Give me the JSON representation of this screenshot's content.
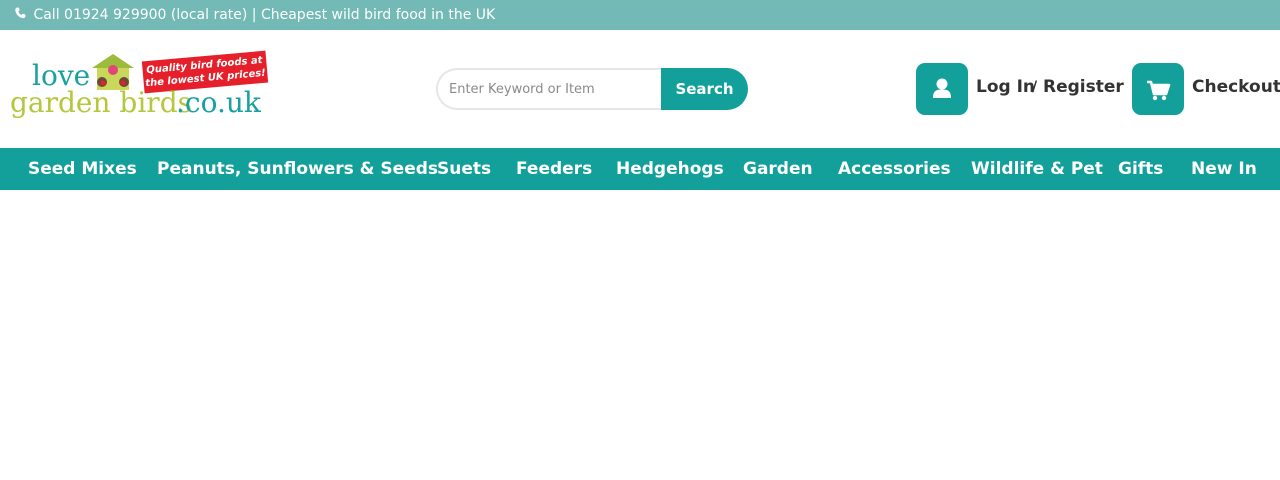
{
  "topbar": {
    "phone_icon": "phone-icon",
    "text": "Call 01924 929900 (local rate) | Cheapest wild bird food in the UK"
  },
  "logo": {
    "word_love": "love",
    "word_garden_birds": "garden birds",
    "word_domain": ".co.uk",
    "sticker_line1": "Quality bird foods at",
    "sticker_line2": "the lowest UK prices!"
  },
  "search": {
    "placeholder": "Enter Keyword or Item",
    "button_label": "Search"
  },
  "account": {
    "user_icon": "user-icon",
    "login_label": "Log In",
    "separator": "/",
    "register_label": "Register",
    "cart_icon": "shopping-cart-icon",
    "checkout_label": "Checkout"
  },
  "nav": {
    "items": [
      "Seed Mixes",
      "Peanuts, Sunflowers & Seeds",
      "Suets",
      "Feeders",
      "Hedgehogs",
      "Garden",
      "Accessories",
      "Wildlife & Pet",
      "Gifts",
      "New In"
    ]
  },
  "colors": {
    "topbar": "#73b9b6",
    "brand_teal": "#14a09a",
    "logo_green": "#b3c83a",
    "sticker_red": "#e5202a"
  }
}
